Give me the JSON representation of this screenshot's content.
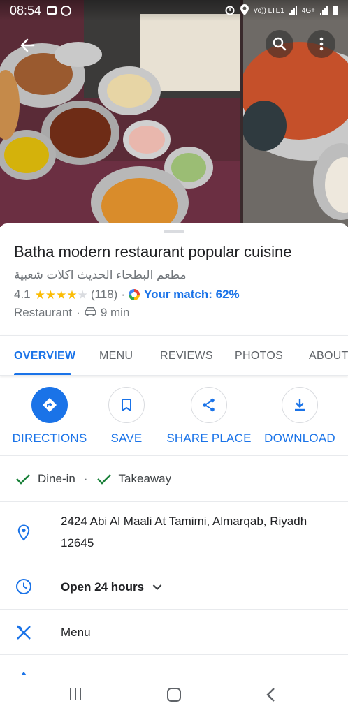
{
  "status_bar": {
    "time": "08:54",
    "carrier_label": "Vo)) LTE1",
    "network_label": "4G+"
  },
  "header": {
    "back_icon": "arrow-left-icon",
    "search_icon": "search-icon",
    "more_icon": "more-vert-icon"
  },
  "place": {
    "name": "Batha modern restaurant popular cuisine",
    "name_local": "مطعم البطحاء الحديث اكلات شعبية",
    "rating": "4.1",
    "stars": 4,
    "review_count": "(118)",
    "match_text": "Your match: 62%",
    "category": "Restaurant",
    "drive_time": "9 min"
  },
  "tabs": [
    {
      "label": "OVERVIEW",
      "active": true
    },
    {
      "label": "MENU",
      "active": false
    },
    {
      "label": "REVIEWS",
      "active": false
    },
    {
      "label": "PHOTOS",
      "active": false
    },
    {
      "label": "ABOUT",
      "active": false
    }
  ],
  "actions": [
    {
      "label": "DIRECTIONS",
      "icon": "directions-icon"
    },
    {
      "label": "SAVE",
      "icon": "bookmark-icon"
    },
    {
      "label": "SHARE PLACE",
      "icon": "share-icon"
    },
    {
      "label": "DOWNLOAD",
      "icon": "download-icon"
    }
  ],
  "services": [
    {
      "label": "Dine-in"
    },
    {
      "label": "Takeaway"
    }
  ],
  "details": {
    "address": "2424 Abi Al Maali At Tamimi, Almarqab, Riyadh 12645",
    "hours": "Open 24 hours",
    "menu_label": "Menu"
  },
  "colors": {
    "accent": "#1a73e8",
    "star": "#fbbc04",
    "check": "#188038",
    "text_secondary": "#70757a"
  }
}
